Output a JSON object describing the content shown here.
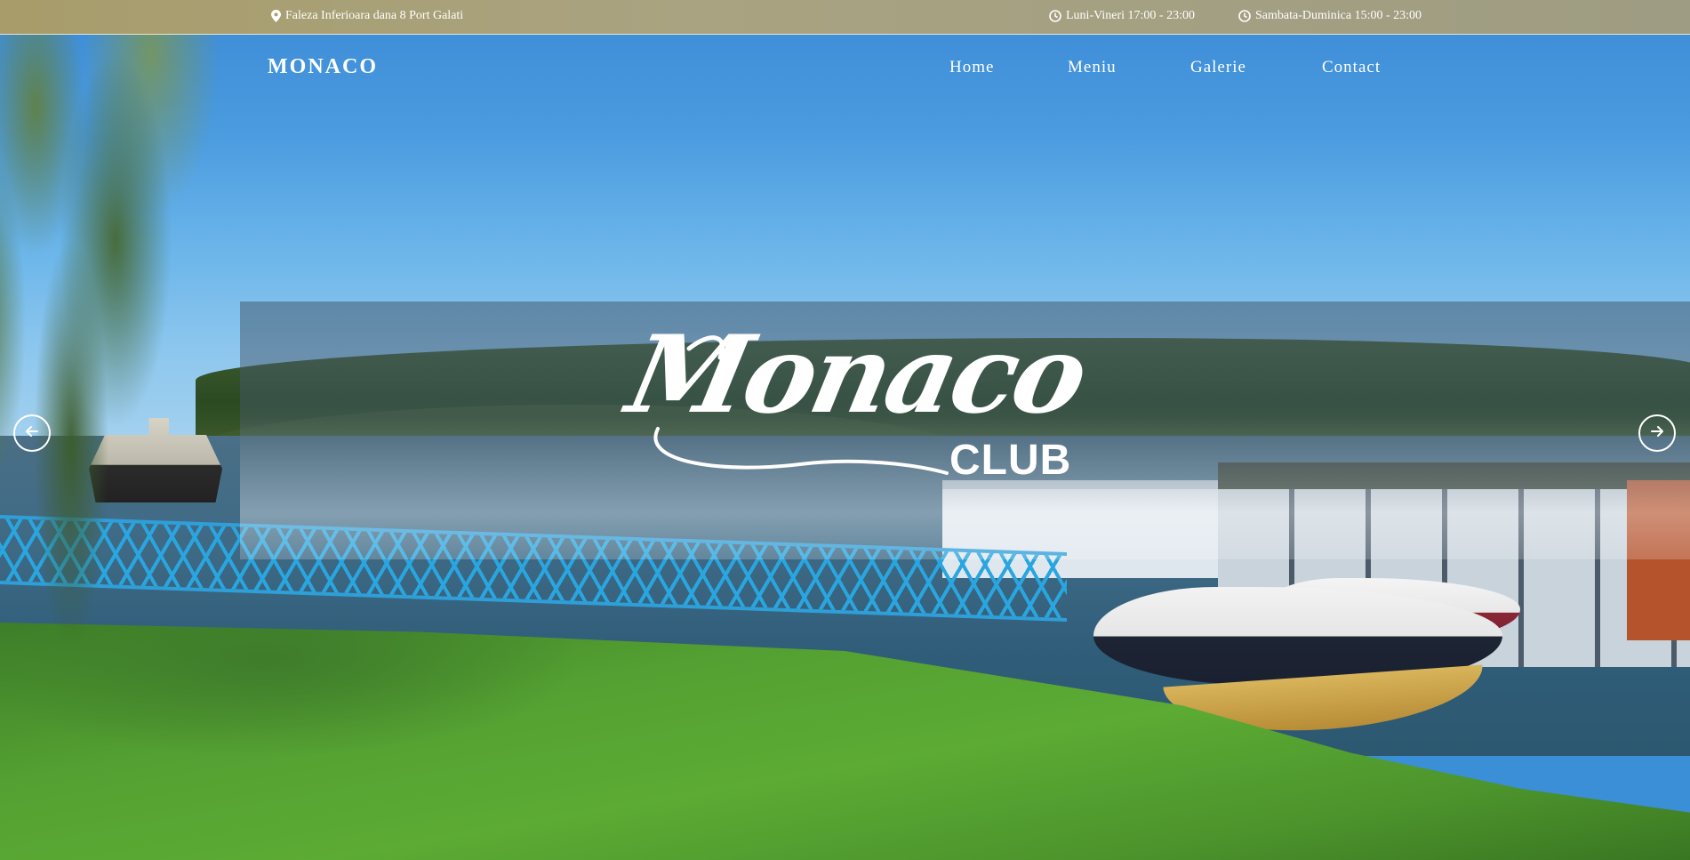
{
  "topbar": {
    "address": "Faleza Inferioara dana 8 Port Galati",
    "address_icon": "map-marker-icon",
    "hours_weekday": "Luni-Vineri 17:00 - 23:00",
    "hours_weekend": "Sambata-Duminica 15:00 - 23:00",
    "hours_icon": "clock-icon"
  },
  "brand": "MONACO",
  "nav": {
    "items": [
      {
        "label": "Home"
      },
      {
        "label": "Meniu"
      },
      {
        "label": "Galerie"
      },
      {
        "label": "Contact"
      }
    ]
  },
  "hero": {
    "logo_script": "Monaco",
    "logo_sub": "CLUB",
    "prev_icon": "arrow-left-icon",
    "next_icon": "arrow-right-icon"
  },
  "colors": {
    "topbar": "#a9a381",
    "accent_white": "#ffffff",
    "sky": "#4c9ce0"
  }
}
